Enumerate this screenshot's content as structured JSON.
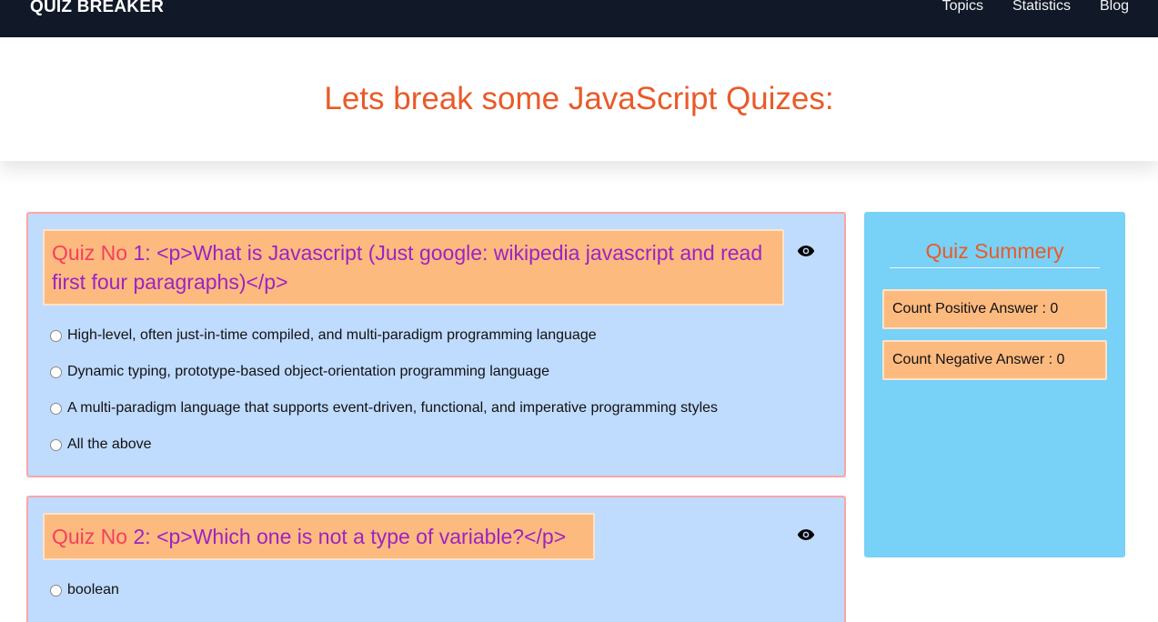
{
  "nav": {
    "brand": "QUIZ BREAKER",
    "links": [
      "Topics",
      "Statistics",
      "Blog"
    ]
  },
  "hero": {
    "title": "Lets break some JavaScript Quizes:"
  },
  "quizzes": [
    {
      "label": "Quiz No",
      "number": "1:",
      "question": "<p>What is Javascript (Just google: wikipedia javascript and read first four paragraphs)</p>",
      "options": [
        "High-level, often just-in-time compiled, and multi-paradigm programming language",
        "Dynamic typing, prototype-based object-orientation programming language",
        "A multi-paradigm language that supports event-driven, functional, and imperative programming styles",
        "All the above"
      ]
    },
    {
      "label": "Quiz No",
      "number": "2:",
      "question": "<p>Which one is not a type of variable?</p>",
      "options": [
        "boolean"
      ]
    }
  ],
  "summary": {
    "title": "Quiz Summery",
    "positive": "Count Positive Answer : 0",
    "negative": "Count Negative Answer : 0"
  },
  "colors": {
    "navbar": "#111827",
    "accent_orange": "#ea5a28",
    "card_bg": "#bfdbfe",
    "card_border": "#fca5a5",
    "question_bg": "#fdba7f",
    "summary_bg": "#78d1f6",
    "quiz_no": "#f43f5e",
    "question_text": "#9d22c4"
  },
  "icons": {
    "reveal": "eye-icon"
  }
}
